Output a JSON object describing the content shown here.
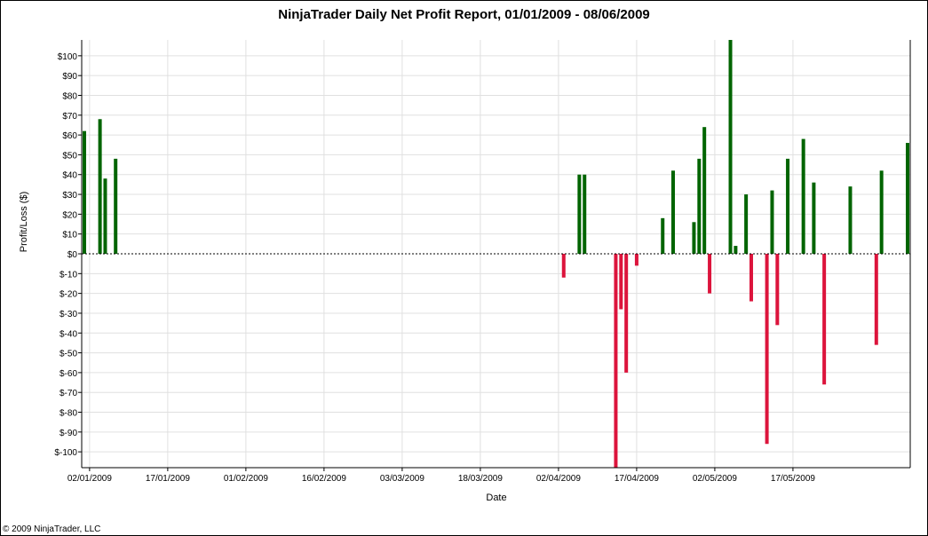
{
  "title": "NinjaTrader Daily Net Profit Report, 01/01/2009 - 08/06/2009",
  "footer": "© 2009 NinjaTrader, LLC",
  "colors": {
    "profit": "#006400",
    "loss": "#dc143c",
    "grid": "#e0e0e0"
  },
  "chart_data": {
    "type": "bar",
    "title": "NinjaTrader Daily Net Profit Report, 01/01/2009 - 08/06/2009",
    "xlabel": "Date",
    "ylabel": "Profit/Loss ($)",
    "ylim": [
      -108,
      108
    ],
    "xlim": [
      "2009-01-01",
      "2009-06-08"
    ],
    "grid": true,
    "yticks": [
      -100,
      -90,
      -80,
      -70,
      -60,
      -50,
      -40,
      -30,
      -20,
      -10,
      0,
      10,
      20,
      30,
      40,
      50,
      60,
      70,
      80,
      90,
      100
    ],
    "ytick_labels": [
      "$-100",
      "$-90",
      "$-80",
      "$-70",
      "$-60",
      "$-50",
      "$-40",
      "$-30",
      "$-20",
      "$-10",
      "$0",
      "$10",
      "$20",
      "$30",
      "$40",
      "$50",
      "$60",
      "$70",
      "$80",
      "$90",
      "$100"
    ],
    "xticks": [
      "2009-01-02",
      "2009-01-17",
      "2009-02-01",
      "2009-02-16",
      "2009-03-03",
      "2009-03-18",
      "2009-04-02",
      "2009-04-17",
      "2009-05-02",
      "2009-05-17"
    ],
    "xtick_labels": [
      "02/01/2009",
      "17/01/2009",
      "01/02/2009",
      "16/02/2009",
      "03/03/2009",
      "18/03/2009",
      "02/04/2009",
      "17/04/2009",
      "02/05/2009",
      "17/05/2009"
    ],
    "points": [
      {
        "date": "2009-01-01",
        "value": 62
      },
      {
        "date": "2009-01-04",
        "value": 68
      },
      {
        "date": "2009-01-05",
        "value": 38
      },
      {
        "date": "2009-01-07",
        "value": 48
      },
      {
        "date": "2009-04-03",
        "value": -12
      },
      {
        "date": "2009-04-06",
        "value": 40
      },
      {
        "date": "2009-04-07",
        "value": 40
      },
      {
        "date": "2009-04-13",
        "value": -108
      },
      {
        "date": "2009-04-14",
        "value": -28
      },
      {
        "date": "2009-04-15",
        "value": -60
      },
      {
        "date": "2009-04-17",
        "value": -6
      },
      {
        "date": "2009-04-22",
        "value": 18
      },
      {
        "date": "2009-04-24",
        "value": 42
      },
      {
        "date": "2009-04-28",
        "value": 16
      },
      {
        "date": "2009-04-29",
        "value": 48
      },
      {
        "date": "2009-04-30",
        "value": 64
      },
      {
        "date": "2009-05-01",
        "value": -20
      },
      {
        "date": "2009-05-05",
        "value": 108
      },
      {
        "date": "2009-05-06",
        "value": 4
      },
      {
        "date": "2009-05-08",
        "value": 30
      },
      {
        "date": "2009-05-09",
        "value": -24
      },
      {
        "date": "2009-05-12",
        "value": -96
      },
      {
        "date": "2009-05-13",
        "value": 32
      },
      {
        "date": "2009-05-14",
        "value": -36
      },
      {
        "date": "2009-05-16",
        "value": 48
      },
      {
        "date": "2009-05-19",
        "value": 58
      },
      {
        "date": "2009-05-21",
        "value": 36
      },
      {
        "date": "2009-05-23",
        "value": -66
      },
      {
        "date": "2009-05-28",
        "value": 34
      },
      {
        "date": "2009-06-02",
        "value": -46
      },
      {
        "date": "2009-06-03",
        "value": 42
      },
      {
        "date": "2009-06-08",
        "value": 56
      }
    ]
  }
}
